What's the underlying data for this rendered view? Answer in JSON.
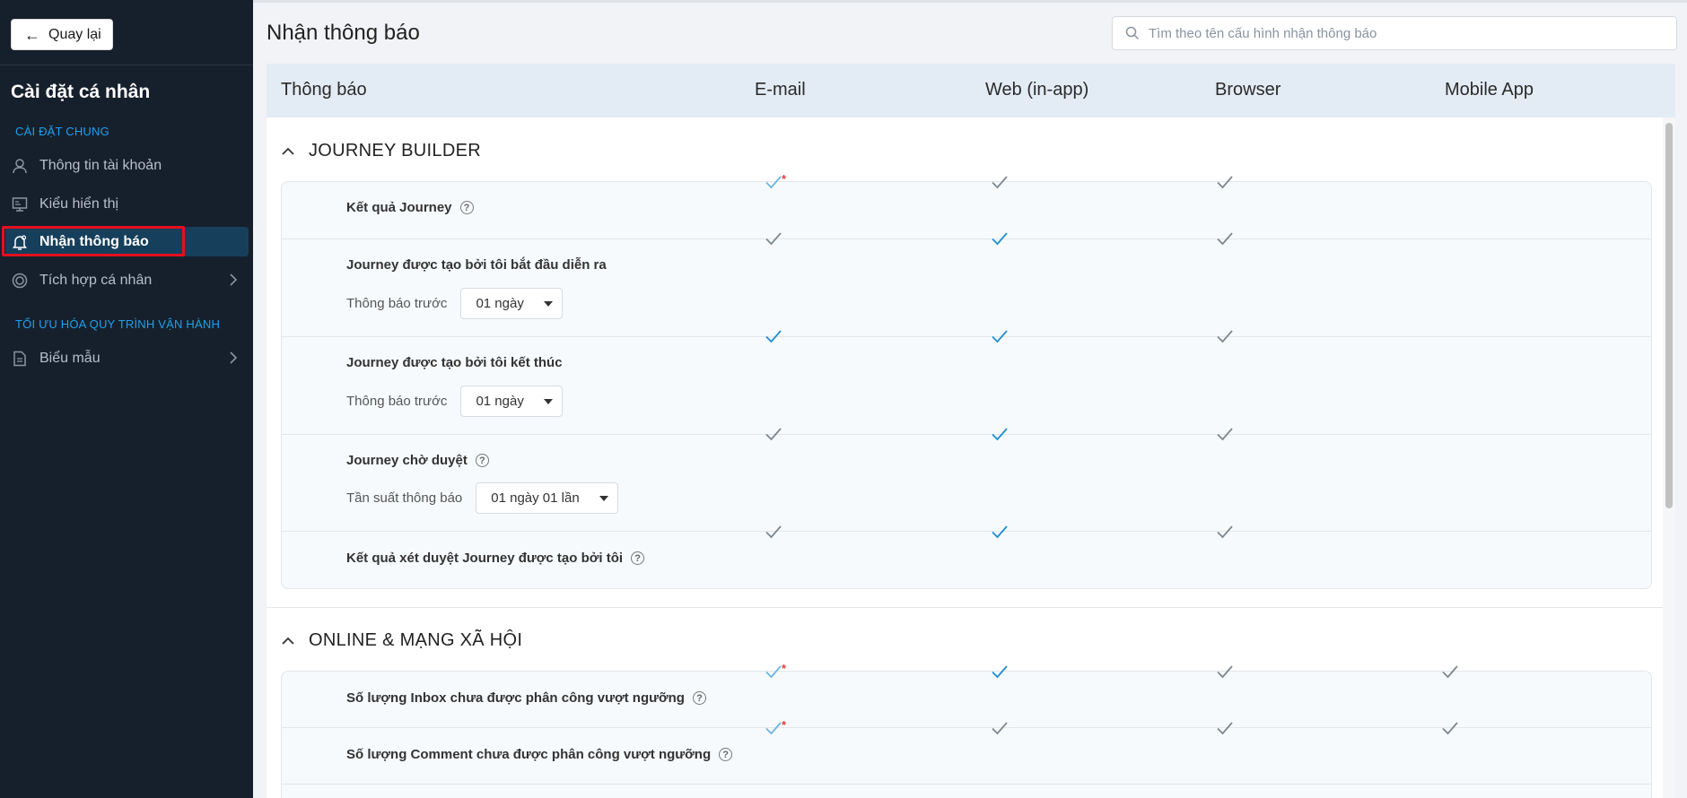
{
  "sidebar": {
    "back_label": "Quay lại",
    "title": "Cài đặt cá nhân",
    "section1": "CÀI ĐẶT CHUNG",
    "section2": "TỐI ƯU HÓA QUY TRÌNH VẬN HÀNH",
    "items": [
      {
        "label": "Thông tin tài khoản",
        "icon": "user-icon"
      },
      {
        "label": "Kiểu hiển thị",
        "icon": "display-icon"
      },
      {
        "label": "Nhận thông báo",
        "icon": "bell-icon",
        "active": true
      },
      {
        "label": "Tích hợp cá nhân",
        "icon": "integration-icon"
      },
      {
        "label": "Biểu mẫu",
        "icon": "form-icon"
      }
    ]
  },
  "header": {
    "title": "Nhận thông báo",
    "search_placeholder": "Tìm theo tên cấu hình nhận thông báo"
  },
  "table": {
    "columns": [
      "Thông báo",
      "E-mail",
      "Web (in-app)",
      "Browser",
      "Mobile App"
    ]
  },
  "colors": {
    "check_off": "#7f8891",
    "check_on": "#1f8fd1",
    "required_star": "#e23b3b",
    "sidebar_bg": "#16202c",
    "active_bg": "#163f5c"
  },
  "groups": [
    {
      "title": "JOURNEY BUILDER",
      "rows": [
        {
          "label": "Kết quả Journey",
          "help": true,
          "checks": [
            "required",
            "off",
            "off",
            null
          ]
        },
        {
          "label": "Journey được tạo bởi tôi bắt đầu diễn ra",
          "sub_label": "Thông báo trước",
          "select": "01 ngày",
          "checks": [
            "off",
            "on",
            "off",
            null
          ]
        },
        {
          "label": "Journey được tạo bởi tôi kết thúc",
          "sub_label": "Thông báo trước",
          "select": "01 ngày",
          "checks": [
            "on",
            "on",
            "off",
            null
          ]
        },
        {
          "label": "Journey chờ duyệt",
          "help": true,
          "sub_label": "Tần suất thông báo",
          "select": "01 ngày 01 lần",
          "checks": [
            "off",
            "on",
            "off",
            null
          ]
        },
        {
          "label": "Kết quả xét duyệt Journey được tạo bởi tôi",
          "help": true,
          "checks": [
            "off",
            "on",
            "off",
            null
          ]
        }
      ]
    },
    {
      "title": "ONLINE & MẠNG XÃ HỘI",
      "rows": [
        {
          "label": "Số lượng Inbox chưa được phân công vượt ngưỡng",
          "help": true,
          "checks": [
            "required",
            "on",
            "off",
            "off"
          ]
        },
        {
          "label": "Số lượng Comment chưa được phân công vượt ngưỡng",
          "help": true,
          "checks": [
            "required",
            "off",
            "off",
            "off"
          ]
        }
      ]
    }
  ]
}
